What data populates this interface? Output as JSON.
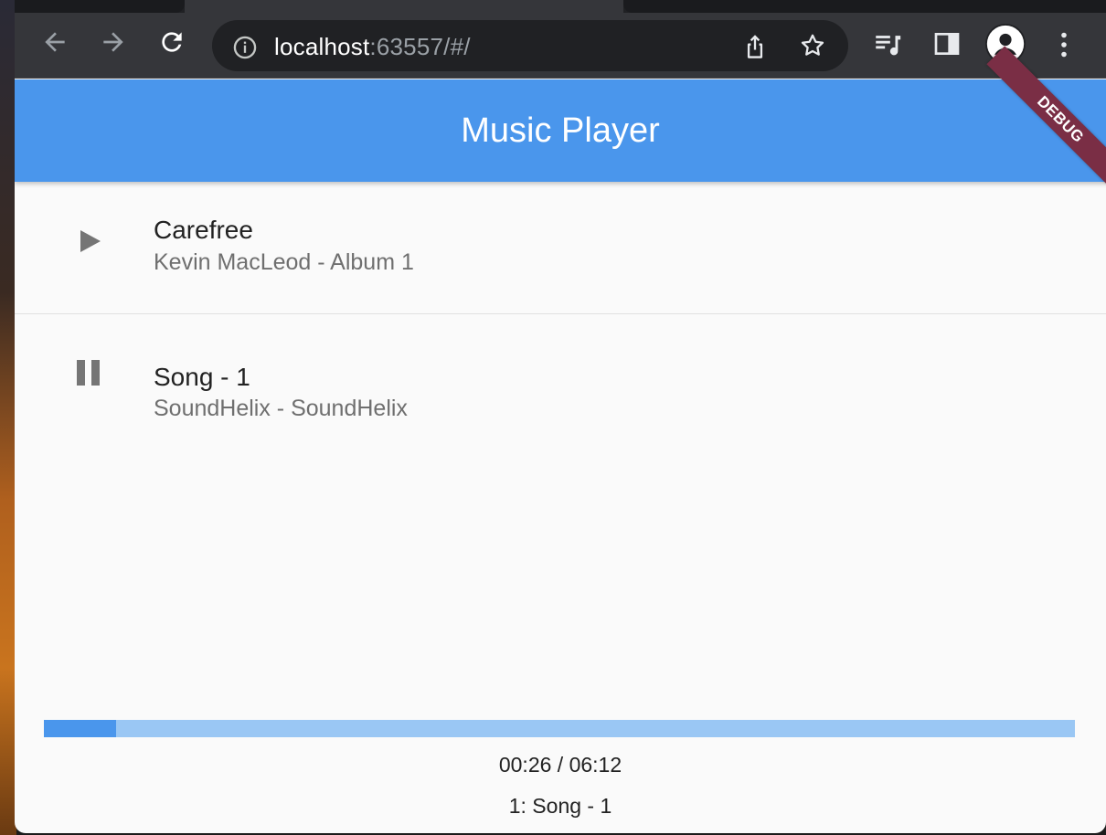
{
  "browser": {
    "url_host": "localhost",
    "url_rest": ":63557/#/"
  },
  "app": {
    "title": "Music Player",
    "debug_label": "DEBUG",
    "accent_color": "#4a96ec"
  },
  "songs": [
    {
      "title": "Carefree",
      "subtitle": "Kevin MacLeod - Album 1",
      "state_icon": "play-icon"
    },
    {
      "title": "Song - 1",
      "subtitle": "SoundHelix - SoundHelix",
      "state_icon": "pause-icon"
    }
  ],
  "player": {
    "progress_fraction": 0.07,
    "time_text": "00:26 / 06:12",
    "now_playing": "1: Song - 1"
  }
}
